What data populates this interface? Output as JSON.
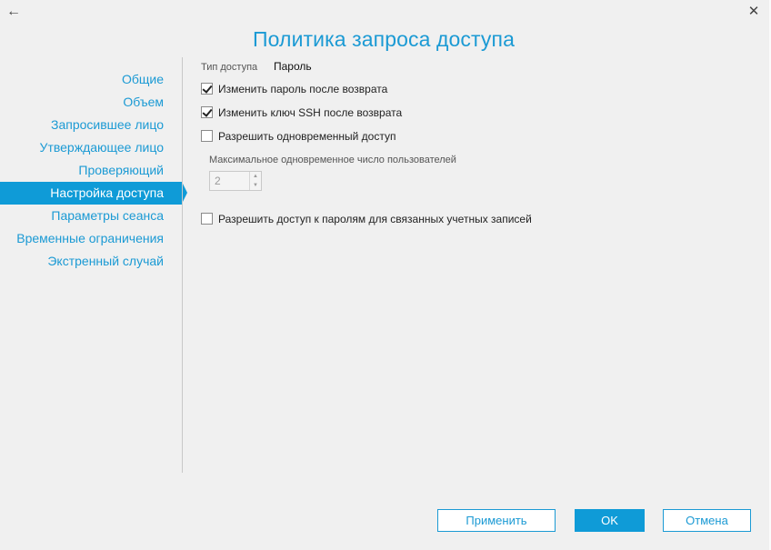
{
  "window": {
    "back_glyph": "←",
    "close_glyph": "✕"
  },
  "page": {
    "title": "Политика запроса доступа"
  },
  "nav": {
    "items": [
      {
        "label": "Общие",
        "active": false
      },
      {
        "label": "Объем",
        "active": false
      },
      {
        "label": "Запросившее лицо",
        "active": false
      },
      {
        "label": "Утверждающее лицо",
        "active": false
      },
      {
        "label": "Проверяющий",
        "active": false
      },
      {
        "label": "Настройка доступа",
        "active": true
      },
      {
        "label": "Параметры сеанса",
        "active": false
      },
      {
        "label": "Временные ограничения",
        "active": false
      },
      {
        "label": "Экстренный случай",
        "active": false
      }
    ]
  },
  "access": {
    "type_label": "Тип доступа",
    "type_value": "Пароль",
    "options": [
      {
        "label": "Изменить пароль после возврата",
        "checked": true
      },
      {
        "label": "Изменить ключ SSH после возврата",
        "checked": true
      },
      {
        "label": "Разрешить одновременный доступ",
        "checked": false
      },
      {
        "label": "Разрешить доступ к паролям для связанных учетных записей",
        "checked": false
      }
    ],
    "max_users_label": "Максимальное одновременное число пользователей",
    "max_users_value": "2",
    "max_users_enabled": false
  },
  "footer": {
    "apply_label": "Применить",
    "ok_label": "OK",
    "cancel_label": "Отмена"
  },
  "colors": {
    "accent": "#1b9ad4",
    "active_nav": "#0f9bd7",
    "background": "#f0f0f0"
  }
}
